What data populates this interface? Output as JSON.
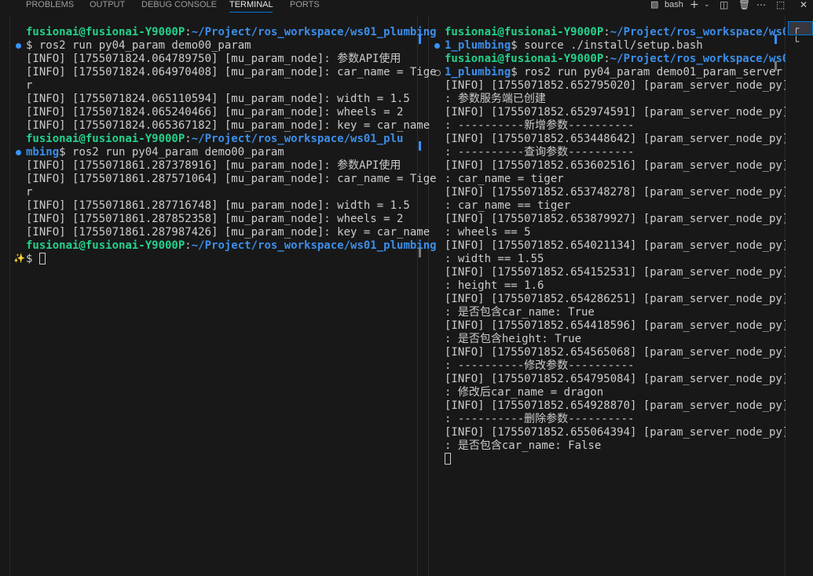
{
  "tabs": [
    {
      "label": "PROBLEMS",
      "active": false
    },
    {
      "label": "OUTPUT",
      "active": false
    },
    {
      "label": "DEBUG CONSOLE",
      "active": false
    },
    {
      "label": "TERMINAL",
      "active": true
    },
    {
      "label": "PORTS",
      "active": false
    }
  ],
  "toolbar": {
    "shell_label": "bash",
    "terminal_icon": "terminal-icon",
    "add_icon": "plus-icon",
    "dropdown_icon": "chevron-down-icon",
    "split_icon": "split-icon",
    "trash_icon": "trash-icon",
    "more_icon": "ellipsis-icon",
    "maximize_icon": "maximize-icon"
  },
  "colors": {
    "user": "#23d18b",
    "path": "#3b8eea",
    "text": "#cccccc",
    "accent": "#0078d4"
  },
  "left_terminal": {
    "lines": [
      {
        "user": "fusionai@fusionai-Y9000P",
        "sep": ":",
        "path": "~/Project/ros_workspace/ws01_plumbing"
      },
      {
        "text": "$ ros2 run py04_param demo00_param"
      },
      {
        "text": "[INFO] [1755071824.064789750] [mu_param_node]: 参数API使用"
      },
      {
        "text": "[INFO] [1755071824.064970408] [mu_param_node]: car_name = Tige"
      },
      {
        "text": "r"
      },
      {
        "text": "[INFO] [1755071824.065110594] [mu_param_node]: width = 1.5"
      },
      {
        "text": "[INFO] [1755071824.065240466] [mu_param_node]: wheels = 2"
      },
      {
        "text": "[INFO] [1755071824.065367182] [mu_param_node]: key = car_name"
      },
      {
        "user": "fusionai@fusionai-Y9000P",
        "sep": ":",
        "path": "~/Project/ros_workspace/ws01_plu"
      },
      {
        "path": "mbing",
        "text": "$ ros2 run py04_param demo00_param"
      },
      {
        "text": "[INFO] [1755071861.287378916] [mu_param_node]: 参数API使用"
      },
      {
        "text": "[INFO] [1755071861.287571064] [mu_param_node]: car_name = Tige"
      },
      {
        "text": "r"
      },
      {
        "text": "[INFO] [1755071861.287716748] [mu_param_node]: width = 1.5"
      },
      {
        "text": "[INFO] [1755071861.287852358] [mu_param_node]: wheels = 2"
      },
      {
        "text": "[INFO] [1755071861.287987426] [mu_param_node]: key = car_name"
      },
      {
        "user": "fusionai@fusionai-Y9000P",
        "sep": ":",
        "path": "~/Project/ros_workspace/ws01_plumbing"
      },
      {
        "text": "$ ",
        "cursor": true
      }
    ]
  },
  "right_terminal": {
    "lines": [
      {
        "user": "fusionai@fusionai-Y9000P",
        "sep": ":",
        "path": "~/Project/ros_workspace/ws0"
      },
      {
        "path": "1_plumbing",
        "text": "$ source ./install/setup.bash"
      },
      {
        "user": "fusionai@fusionai-Y9000P",
        "sep": ":",
        "path": "~/Project/ros_workspace/ws0"
      },
      {
        "path": "1_plumbing",
        "text": "$ ros2 run py04_param demo01_param_server"
      },
      {
        "text": "[INFO] [1755071852.652795020] [param_server_node_py]"
      },
      {
        "text": ": 参数服务端已创建"
      },
      {
        "text": "[INFO] [1755071852.652974591] [param_server_node_py]"
      },
      {
        "text": ": ----------新增参数----------"
      },
      {
        "text": "[INFO] [1755071852.653448642] [param_server_node_py]"
      },
      {
        "text": ": ----------查询参数----------"
      },
      {
        "text": "[INFO] [1755071852.653602516] [param_server_node_py]"
      },
      {
        "text": ": car_name = tiger"
      },
      {
        "text": "[INFO] [1755071852.653748278] [param_server_node_py]"
      },
      {
        "text": ": car_name == tiger"
      },
      {
        "text": "[INFO] [1755071852.653879927] [param_server_node_py]"
      },
      {
        "text": ": wheels == 5"
      },
      {
        "text": "[INFO] [1755071852.654021134] [param_server_node_py]"
      },
      {
        "text": ": width == 1.55"
      },
      {
        "text": "[INFO] [1755071852.654152531] [param_server_node_py]"
      },
      {
        "text": ": height == 1.6"
      },
      {
        "text": "[INFO] [1755071852.654286251] [param_server_node_py]"
      },
      {
        "text": ": 是否包含car_name: True"
      },
      {
        "text": "[INFO] [1755071852.654418596] [param_server_node_py]"
      },
      {
        "text": ": 是否包含height: True"
      },
      {
        "text": "[INFO] [1755071852.654565068] [param_server_node_py]"
      },
      {
        "text": ": ----------修改参数----------"
      },
      {
        "text": "[INFO] [1755071852.654795084] [param_server_node_py]"
      },
      {
        "text": ": 修改后car_name = dragon"
      },
      {
        "text": "[INFO] [1755071852.654928870] [param_server_node_py]"
      },
      {
        "text": ": ----------删除参数----------"
      },
      {
        "text": "[INFO] [1755071852.655064394] [param_server_node_py]"
      },
      {
        "text": ": 是否包含car_name: False"
      },
      {
        "text": "",
        "cursor": true
      }
    ]
  }
}
